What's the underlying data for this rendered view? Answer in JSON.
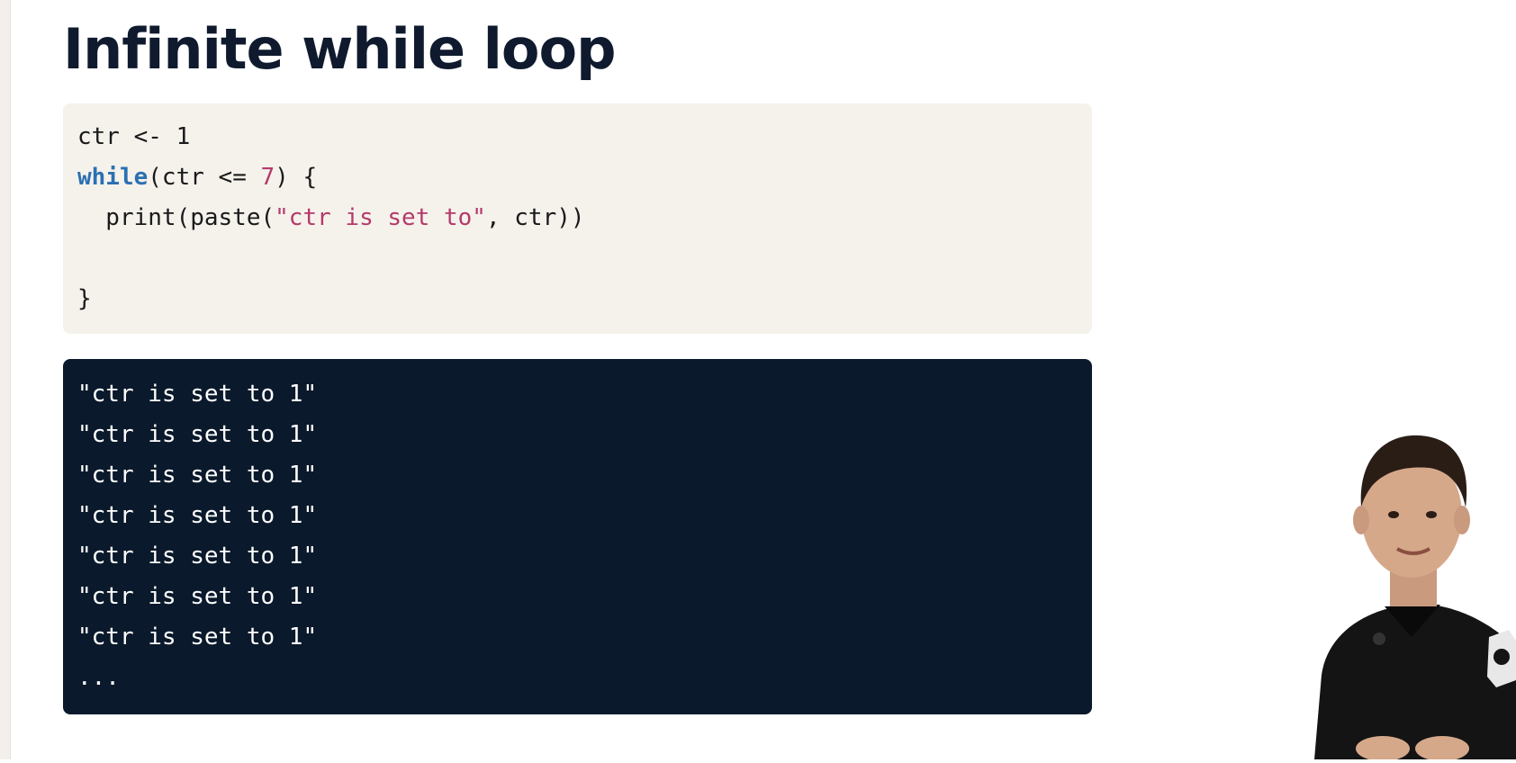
{
  "slide": {
    "title": "Infinite while loop"
  },
  "code_block": {
    "line1": "ctr <- 1",
    "line2_keyword": "while",
    "line2_open": "(ctr <= ",
    "line2_number": "7",
    "line2_close": ") {",
    "line3_indent_call": "  print(paste(",
    "line3_string": "\"ctr is set to\"",
    "line3_rest": ", ctr))",
    "line4": "",
    "line5": "}"
  },
  "output_block": {
    "lines": [
      "\"ctr is set to 1\"",
      "\"ctr is set to 1\"",
      "\"ctr is set to 1\"",
      "\"ctr is set to 1\"",
      "\"ctr is set to 1\"",
      "\"ctr is set to 1\"",
      "\"ctr is set to 1\"",
      "..."
    ]
  },
  "colors": {
    "title": "#0f1a2e",
    "code_background": "#f5f2ec",
    "output_background": "#0a192b",
    "keyword": "#2c70b2",
    "string": "#b43a6b"
  },
  "presenter": {
    "icon": "presenter-video-thumbnail"
  }
}
